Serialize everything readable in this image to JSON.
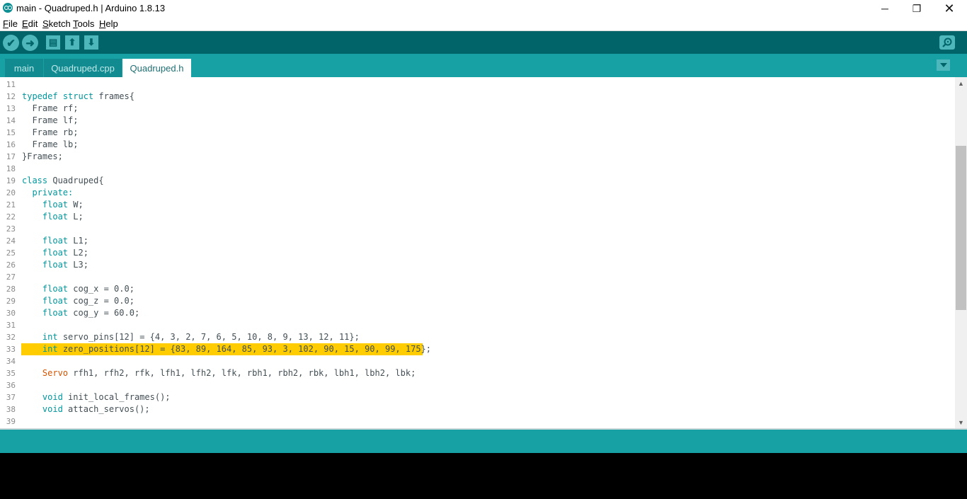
{
  "window": {
    "title": "main - Quadruped.h | Arduino 1.8.13",
    "min_glyph": "─",
    "max_glyph": "❐",
    "close_glyph": "✕"
  },
  "menu": [
    {
      "underline": "F",
      "rest": "ile"
    },
    {
      "underline": "E",
      "rest": "dit"
    },
    {
      "underline": "S",
      "rest": "ketch"
    },
    {
      "underline": "T",
      "rest": "ools"
    },
    {
      "underline": "H",
      "rest": "elp"
    }
  ],
  "toolbar": {
    "verify_icon": "check-icon",
    "upload_icon": "arrow-right-icon",
    "new_icon": "new-file-icon",
    "open_icon": "arrow-up-icon",
    "save_icon": "arrow-down-icon",
    "serial_icon": "magnifier-icon",
    "verify_glyph": "✔",
    "upload_glyph": "➜",
    "new_glyph": "▤",
    "open_glyph": "⬆",
    "save_glyph": "⬇"
  },
  "tabs": [
    {
      "label": "main",
      "active": false
    },
    {
      "label": "Quadruped.cpp",
      "active": false
    },
    {
      "label": "Quadruped.h",
      "active": true
    }
  ],
  "editor": {
    "highlighted_line": 33,
    "lines": [
      {
        "n": "11",
        "parts": []
      },
      {
        "n": "12",
        "parts": [
          {
            "t": "kw",
            "v": "typedef"
          },
          {
            "t": "p",
            "v": " "
          },
          {
            "t": "kw",
            "v": "struct"
          },
          {
            "t": "p",
            "v": " frames{"
          }
        ]
      },
      {
        "n": "13",
        "parts": [
          {
            "t": "p",
            "v": "  Frame rf;"
          }
        ]
      },
      {
        "n": "14",
        "parts": [
          {
            "t": "p",
            "v": "  Frame lf;"
          }
        ]
      },
      {
        "n": "15",
        "parts": [
          {
            "t": "p",
            "v": "  Frame rb;"
          }
        ]
      },
      {
        "n": "16",
        "parts": [
          {
            "t": "p",
            "v": "  Frame lb;"
          }
        ]
      },
      {
        "n": "17",
        "parts": [
          {
            "t": "p",
            "v": "}Frames;"
          }
        ]
      },
      {
        "n": "18",
        "parts": []
      },
      {
        "n": "19",
        "parts": [
          {
            "t": "kw",
            "v": "class"
          },
          {
            "t": "p",
            "v": " Quadruped{"
          }
        ]
      },
      {
        "n": "20",
        "parts": [
          {
            "t": "p",
            "v": "  "
          },
          {
            "t": "kw",
            "v": "private:"
          }
        ]
      },
      {
        "n": "21",
        "parts": [
          {
            "t": "p",
            "v": "    "
          },
          {
            "t": "kw",
            "v": "float"
          },
          {
            "t": "p",
            "v": " W;"
          }
        ]
      },
      {
        "n": "22",
        "parts": [
          {
            "t": "p",
            "v": "    "
          },
          {
            "t": "kw",
            "v": "float"
          },
          {
            "t": "p",
            "v": " L;"
          }
        ]
      },
      {
        "n": "23",
        "parts": []
      },
      {
        "n": "24",
        "parts": [
          {
            "t": "p",
            "v": "    "
          },
          {
            "t": "kw",
            "v": "float"
          },
          {
            "t": "p",
            "v": " L1;"
          }
        ]
      },
      {
        "n": "25",
        "parts": [
          {
            "t": "p",
            "v": "    "
          },
          {
            "t": "kw",
            "v": "float"
          },
          {
            "t": "p",
            "v": " L2;"
          }
        ]
      },
      {
        "n": "26",
        "parts": [
          {
            "t": "p",
            "v": "    "
          },
          {
            "t": "kw",
            "v": "float"
          },
          {
            "t": "p",
            "v": " L3;"
          }
        ]
      },
      {
        "n": "27",
        "parts": []
      },
      {
        "n": "28",
        "parts": [
          {
            "t": "p",
            "v": "    "
          },
          {
            "t": "kw",
            "v": "float"
          },
          {
            "t": "p",
            "v": " cog_x = 0.0;"
          }
        ]
      },
      {
        "n": "29",
        "parts": [
          {
            "t": "p",
            "v": "    "
          },
          {
            "t": "kw",
            "v": "float"
          },
          {
            "t": "p",
            "v": " cog_z = 0.0;"
          }
        ]
      },
      {
        "n": "30",
        "parts": [
          {
            "t": "p",
            "v": "    "
          },
          {
            "t": "kw",
            "v": "float"
          },
          {
            "t": "p",
            "v": " cog_y = 60.0;"
          }
        ]
      },
      {
        "n": "31",
        "parts": []
      },
      {
        "n": "32",
        "parts": [
          {
            "t": "p",
            "v": "    "
          },
          {
            "t": "kw",
            "v": "int"
          },
          {
            "t": "p",
            "v": " servo_pins[12] = {4, 3, 2, 7, 6, 5, 10, 8, 9, 13, 12, 11};"
          }
        ]
      },
      {
        "n": "33",
        "parts": [
          {
            "t": "p",
            "v": "    "
          },
          {
            "t": "kw",
            "v": "int"
          },
          {
            "t": "p",
            "v": " zero_positions[12] = {83, 89, 164, 85, 93, 3, 102, 90, 15, 90, 99, 175};"
          }
        ]
      },
      {
        "n": "34",
        "parts": []
      },
      {
        "n": "35",
        "parts": [
          {
            "t": "p",
            "v": "    "
          },
          {
            "t": "ty",
            "v": "Servo"
          },
          {
            "t": "p",
            "v": " rfh1, rfh2, rfk, lfh1, lfh2, lfk, rbh1, rbh2, rbk, lbh1, lbh2, lbk;"
          }
        ]
      },
      {
        "n": "36",
        "parts": []
      },
      {
        "n": "37",
        "parts": [
          {
            "t": "p",
            "v": "    "
          },
          {
            "t": "kw",
            "v": "void"
          },
          {
            "t": "p",
            "v": " init_local_frames();"
          }
        ]
      },
      {
        "n": "38",
        "parts": [
          {
            "t": "p",
            "v": "    "
          },
          {
            "t": "kw",
            "v": "void"
          },
          {
            "t": "p",
            "v": " attach_servos();"
          }
        ]
      },
      {
        "n": "39",
        "parts": []
      }
    ]
  },
  "colors": {
    "toolbar": "#006468",
    "tabbar": "#17a1a5",
    "keyword": "#00979c",
    "type": "#d35400",
    "highlight": "#ffcc00"
  }
}
